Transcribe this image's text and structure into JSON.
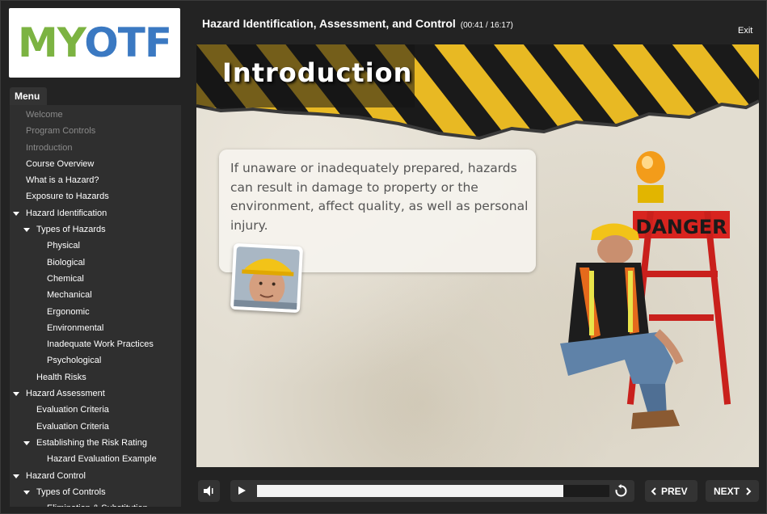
{
  "logo": {
    "left": "MY",
    "right": "OTF"
  },
  "menu": {
    "tab_label": "Menu",
    "items": [
      {
        "label": "Welcome",
        "level": 0,
        "dim": true,
        "expanded": false
      },
      {
        "label": "Program Controls",
        "level": 0,
        "dim": true,
        "expanded": false
      },
      {
        "label": "Introduction",
        "level": 0,
        "dim": true,
        "expanded": false
      },
      {
        "label": "Course Overview",
        "level": 0,
        "dim": false,
        "expanded": false
      },
      {
        "label": "What is a Hazard?",
        "level": 0,
        "dim": false,
        "expanded": false
      },
      {
        "label": "Exposure to Hazards",
        "level": 0,
        "dim": false,
        "expanded": false
      },
      {
        "label": "Hazard Identification",
        "level": 0,
        "dim": false,
        "expanded": true
      },
      {
        "label": "Types of Hazards",
        "level": 1,
        "dim": false,
        "expanded": true
      },
      {
        "label": "Physical",
        "level": 2,
        "dim": false,
        "expanded": false
      },
      {
        "label": "Biological",
        "level": 2,
        "dim": false,
        "expanded": false
      },
      {
        "label": "Chemical",
        "level": 2,
        "dim": false,
        "expanded": false
      },
      {
        "label": "Mechanical",
        "level": 2,
        "dim": false,
        "expanded": false
      },
      {
        "label": "Ergonomic",
        "level": 2,
        "dim": false,
        "expanded": false
      },
      {
        "label": "Environmental",
        "level": 2,
        "dim": false,
        "expanded": false
      },
      {
        "label": "Inadequate Work Practices",
        "level": 2,
        "dim": false,
        "expanded": false
      },
      {
        "label": "Psychological",
        "level": 2,
        "dim": false,
        "expanded": false
      },
      {
        "label": "Health Risks",
        "level": 1,
        "dim": false,
        "expanded": false
      },
      {
        "label": "Hazard Assessment",
        "level": 0,
        "dim": false,
        "expanded": true
      },
      {
        "label": "Evaluation Criteria",
        "level": 1,
        "dim": false,
        "expanded": false
      },
      {
        "label": "Evaluation Criteria",
        "level": 1,
        "dim": false,
        "expanded": false
      },
      {
        "label": "Establishing the Risk Rating",
        "level": 1,
        "dim": false,
        "expanded": true
      },
      {
        "label": "Hazard Evaluation Example",
        "level": 2,
        "dim": false,
        "expanded": false
      },
      {
        "label": "Hazard Control",
        "level": 0,
        "dim": false,
        "expanded": true
      },
      {
        "label": "Types of Controls",
        "level": 1,
        "dim": false,
        "expanded": true
      },
      {
        "label": "Elimination & Substitution",
        "level": 2,
        "dim": false,
        "expanded": false
      }
    ]
  },
  "header": {
    "title": "Hazard Identification, Assessment, and Control",
    "time": "(00:41 / 16:17)",
    "exit_label": "Exit"
  },
  "slide": {
    "heading": "Introduction",
    "bubble_text": "If unaware or inadequately prepared, hazards can result in damage to property or the environment, affect quality, as well as personal injury.",
    "sign_text": "DANGER"
  },
  "player": {
    "progress": 0.87,
    "prev_label": "PREV",
    "next_label": "NEXT"
  },
  "colors": {
    "accent_green": "#7cb342",
    "accent_blue": "#3b79c2",
    "hazard_yellow": "#e8b923",
    "danger_red": "#d8241f"
  }
}
